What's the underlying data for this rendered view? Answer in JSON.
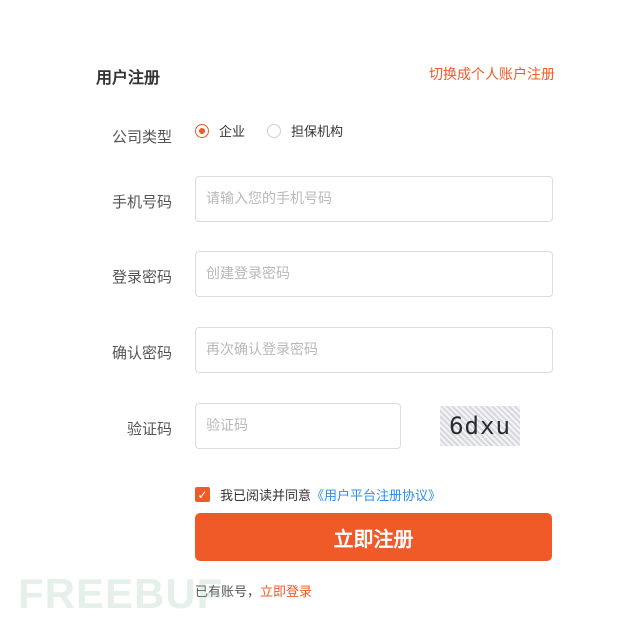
{
  "header": {
    "title": "用户注册",
    "switch_link": "切换成个人账户注册"
  },
  "form": {
    "company_type": {
      "label": "公司类型",
      "options": [
        {
          "label": "企业",
          "selected": true
        },
        {
          "label": "担保机构",
          "selected": false
        }
      ]
    },
    "phone": {
      "label": "手机号码",
      "placeholder": "请输入您的手机号码",
      "value": ""
    },
    "password": {
      "label": "登录密码",
      "placeholder": "创建登录密码",
      "value": ""
    },
    "confirm_password": {
      "label": "确认密码",
      "placeholder": "再次确认登录密码",
      "value": ""
    },
    "captcha": {
      "label": "验证码",
      "placeholder": "验证码",
      "value": "",
      "image_text": "6dxu"
    },
    "agreement": {
      "checked": true,
      "text": "我已阅读并同意",
      "link": "《用户平台注册协议》"
    },
    "submit_label": "立即注册"
  },
  "footer": {
    "have_account": "已有账号，",
    "login_link": "立即登录"
  },
  "watermark": "FREEBUF",
  "colors": {
    "accent": "#f05a28",
    "link_blue": "#2d8cf0",
    "border": "#dcdcdc"
  }
}
